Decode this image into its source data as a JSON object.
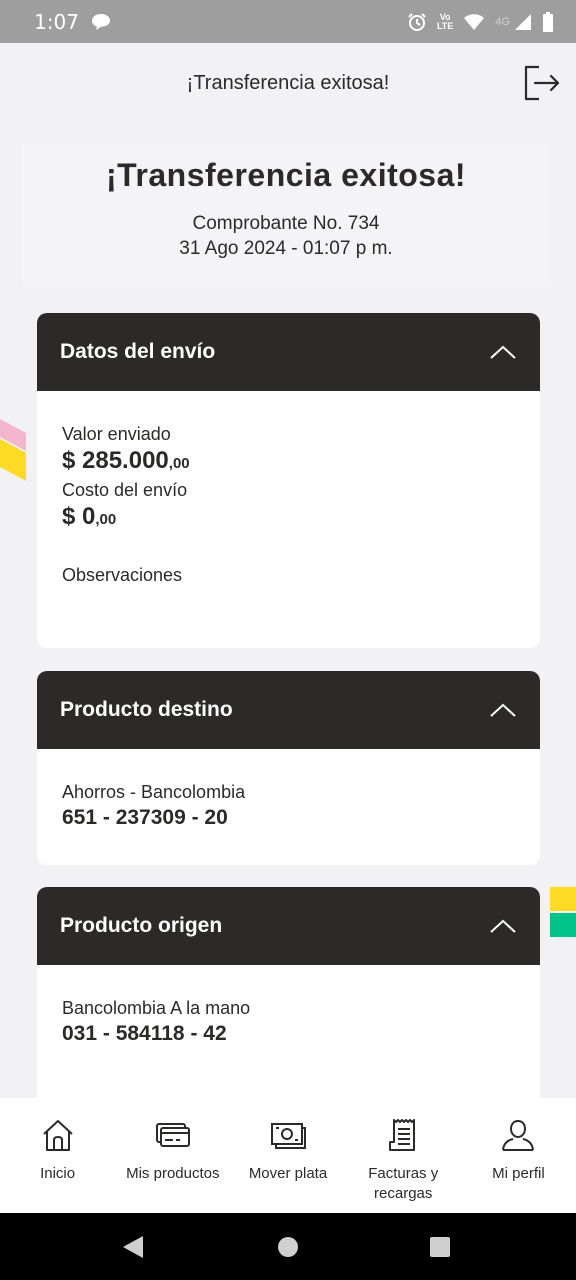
{
  "status_bar": {
    "time": "1:07",
    "lte_top": "Vo",
    "lte_bottom": "LTE",
    "network": "4G"
  },
  "header": {
    "title": "¡Transferencia exitosa!",
    "exit_icon": "logout-icon"
  },
  "summary": {
    "title": "¡Transferencia exitosa!",
    "receipt": "Comprobante No. 734",
    "datetime": "31 Ago 2024 - 01:07 p m."
  },
  "send_details": {
    "title": "Datos del envío",
    "sent_label": "Valor enviado",
    "sent_amount": "$ 285.000",
    "sent_cents": ",00",
    "cost_label": "Costo del envío",
    "cost_amount": "$ 0",
    "cost_cents": ",00",
    "notes_label": "Observaciones"
  },
  "destination": {
    "title": "Producto destino",
    "account_type": "Ahorros - Bancolombia",
    "account_number": "651 - 237309 - 20"
  },
  "origin": {
    "title": "Producto origen",
    "account_type": "Bancolombia A la mano",
    "account_number": "031 - 584118 - 42"
  },
  "bottom_nav": {
    "items": [
      {
        "label": "Inicio",
        "icon": "home-icon"
      },
      {
        "label": "Mis productos",
        "icon": "card-icon"
      },
      {
        "label": "Mover plata",
        "icon": "money-icon"
      },
      {
        "label": "Facturas y recargas",
        "icon": "bill-icon"
      },
      {
        "label": "Mi perfil",
        "icon": "user-icon"
      }
    ]
  },
  "colors": {
    "dark": "#2c2a29",
    "background": "#f2f2f4",
    "accent_yellow": "#fdda24",
    "accent_green": "#00c389",
    "accent_pink": "#f5b6cd"
  }
}
